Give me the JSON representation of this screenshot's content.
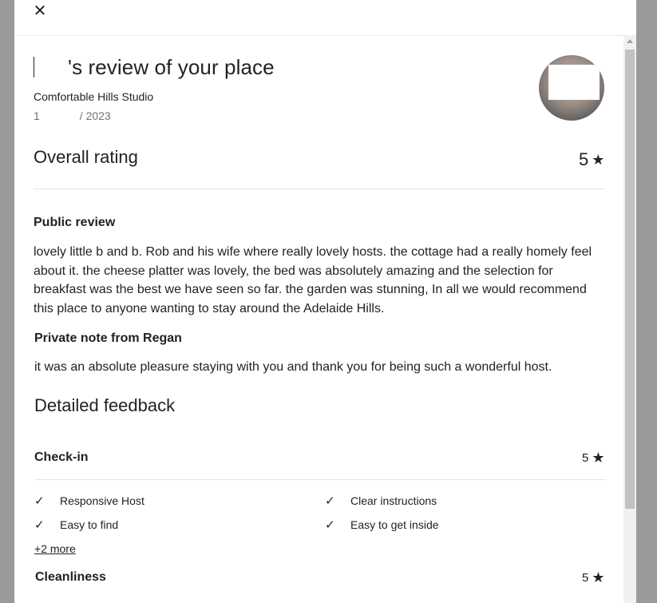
{
  "header": {
    "close_icon": "close-icon"
  },
  "review": {
    "title_suffix": "'s review of your place",
    "listing": "Comfortable Hills Studio",
    "date_prefix": "1",
    "date_suffix": "/ 2023",
    "overall_label": "Overall rating",
    "overall_value": "5",
    "public_heading": "Public review",
    "public_text": "lovely little b and b. Rob and his wife where really lovely hosts. the cottage had a really homely feel about it. the cheese platter was lovely, the bed was absolutely amazing and the selection for breakfast was the best we have seen so far. the garden was stunning, In all we would recommend this place to anyone wanting to stay around the Adelaide Hills.",
    "private_heading": "Private note from Regan",
    "private_text": "it was an absolute pleasure staying with you and thank you for being such a wonderful host.",
    "detailed_heading": "Detailed feedback"
  },
  "categories": [
    {
      "label": "Check-in",
      "value": "5",
      "tags": [
        "Responsive Host",
        "Clear instructions",
        "Easy to find",
        "Easy to get inside"
      ],
      "more": "+2 more"
    },
    {
      "label": "Cleanliness",
      "value": "5"
    }
  ],
  "icons": {
    "star": "★",
    "check": "✓",
    "close": "✕"
  }
}
